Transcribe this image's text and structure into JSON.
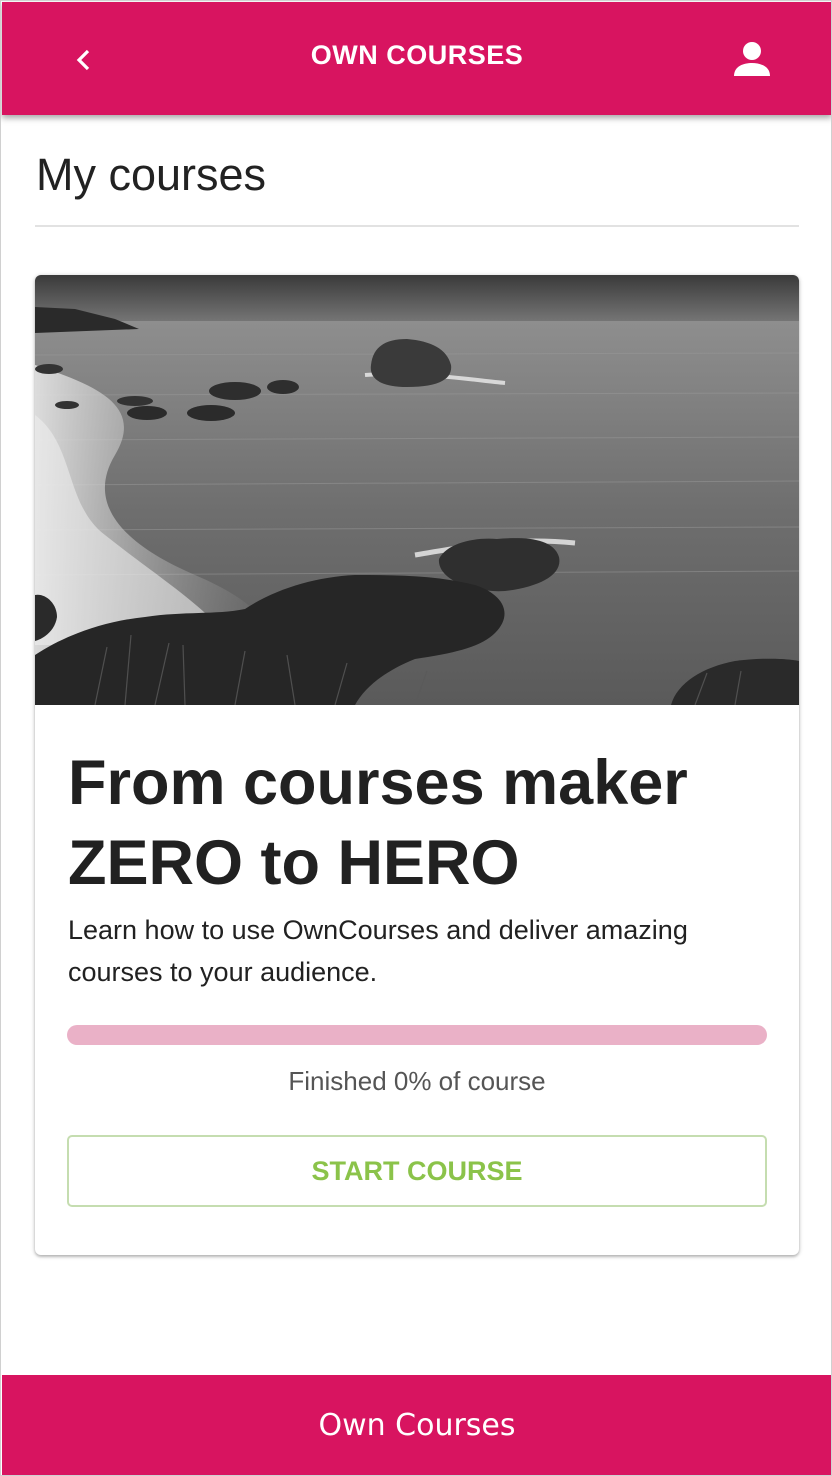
{
  "header": {
    "title": "OWN COURSES",
    "back_icon": "chevron-left-icon",
    "user_icon": "person-icon"
  },
  "main": {
    "title": "My courses"
  },
  "course": {
    "image_description": "black-and-white-sea-coast-photo",
    "title": "From courses maker ZERO to HERO",
    "description": "Learn how to use OwnCourses and deliver amazing courses to your audience.",
    "progress_percent": 0,
    "progress_text": "Finished 0% of course",
    "start_label": "START COURSE"
  },
  "footer": {
    "text": "Own Courses"
  },
  "colors": {
    "brand": "#d81460",
    "progress_track": "#eab1c7",
    "start_button_text": "#8bc34a",
    "start_button_border": "#c5ddb0"
  }
}
